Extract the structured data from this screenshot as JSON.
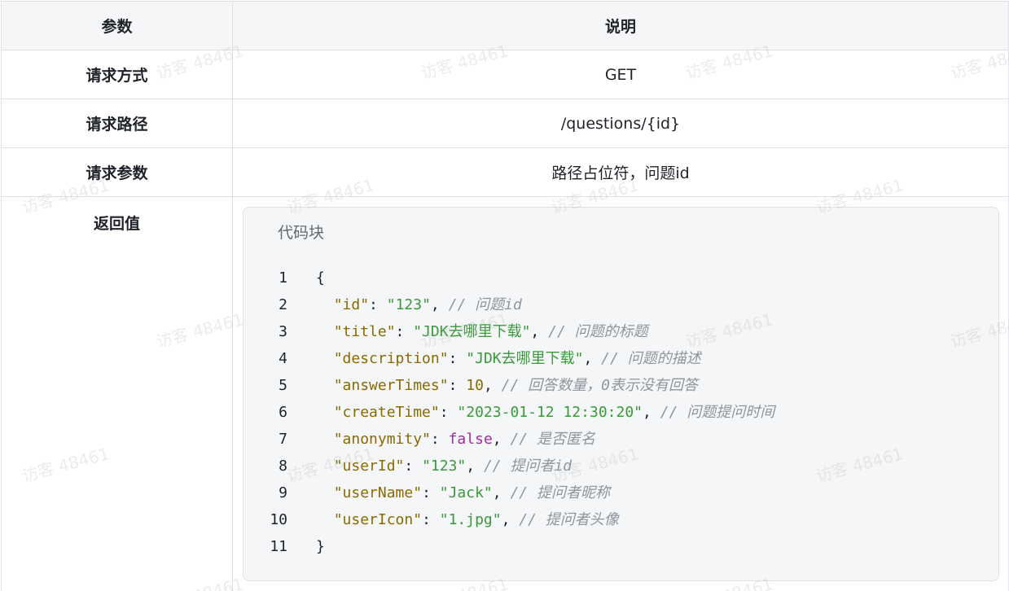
{
  "table": {
    "headers": {
      "param": "参数",
      "desc": "说明"
    },
    "rows": [
      {
        "param": "请求方式",
        "value": "GET"
      },
      {
        "param": "请求路径",
        "value": "/questions/{id}"
      },
      {
        "param": "请求参数",
        "value": "路径占位符，问题id"
      }
    ],
    "return_row": {
      "param": "返回值"
    }
  },
  "code_block": {
    "title": "代码块",
    "lines": [
      {
        "num": "1",
        "open": "{"
      },
      {
        "num": "2",
        "key": "\"id\"",
        "sep": ": ",
        "val": "\"123\"",
        "type": "s",
        "tail": ", ",
        "comment": "// 问题id"
      },
      {
        "num": "3",
        "key": "\"title\"",
        "sep": ": ",
        "val": "\"JDK去哪里下载\"",
        "type": "s",
        "tail": ", ",
        "comment": "// 问题的标题"
      },
      {
        "num": "4",
        "key": "\"description\"",
        "sep": ": ",
        "val": "\"JDK去哪里下载\"",
        "type": "s",
        "tail": ", ",
        "comment": "// 问题的描述"
      },
      {
        "num": "5",
        "key": "\"answerTimes\"",
        "sep": ": ",
        "val": "10",
        "type": "n",
        "tail": ", ",
        "comment": "// 回答数量，0表示没有回答"
      },
      {
        "num": "6",
        "key": "\"createTime\"",
        "sep": ": ",
        "val": "\"2023-01-12 12:30:20\"",
        "type": "s",
        "tail": ", ",
        "comment": "// 问题提问时间"
      },
      {
        "num": "7",
        "key": "\"anonymity\"",
        "sep": ": ",
        "val": "false",
        "type": "b",
        "tail": ", ",
        "comment": "// 是否匿名"
      },
      {
        "num": "8",
        "key": "\"userId\"",
        "sep": ": ",
        "val": "\"123\"",
        "type": "s",
        "tail": ", ",
        "comment": "// 提问者id"
      },
      {
        "num": "9",
        "key": "\"userName\"",
        "sep": ": ",
        "val": "\"Jack\"",
        "type": "s",
        "tail": ", ",
        "comment": "// 提问者昵称"
      },
      {
        "num": "10",
        "key": "\"userIcon\"",
        "sep": ": ",
        "val": "\"1.jpg\"",
        "type": "s",
        "tail": ", ",
        "comment": "// 提问者头像"
      },
      {
        "num": "11",
        "open": "}"
      }
    ]
  },
  "watermark": "访客 48461"
}
